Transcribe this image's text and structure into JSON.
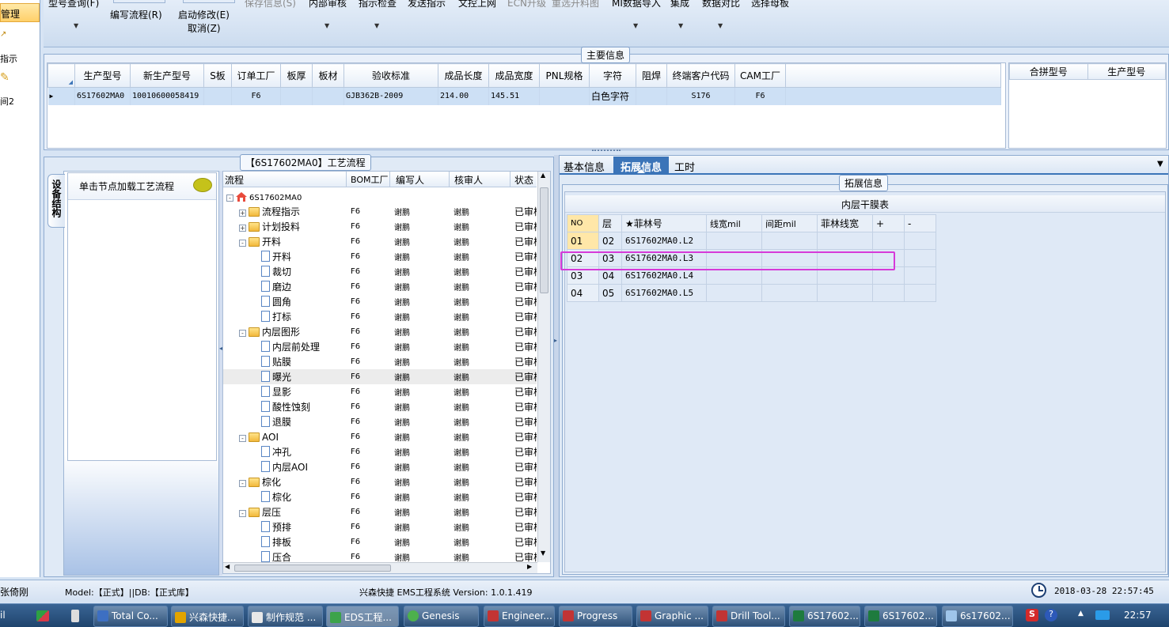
{
  "left_nav": {
    "active": "管理",
    "items": [
      "指示",
      "间2"
    ]
  },
  "toolbar": {
    "buttons": [
      {
        "label": "型号查询(F)",
        "disabled": false
      },
      {
        "label": "编写流程(R)",
        "disabled": false
      },
      {
        "label": "启动修改(E)",
        "disabled": false
      },
      {
        "label": "取消(Z)",
        "disabled": false
      },
      {
        "label": "保存信息(S)",
        "disabled": true
      },
      {
        "label": "内部审核",
        "disabled": false
      },
      {
        "label": "指示检查",
        "disabled": false
      },
      {
        "label": "发送指示",
        "disabled": false
      },
      {
        "label": "文控上网",
        "disabled": false
      },
      {
        "label": "ECN升级",
        "disabled": true
      },
      {
        "label": "重选开料图",
        "disabled": true
      },
      {
        "label": "MI数据导入",
        "disabled": false
      },
      {
        "label": "集成",
        "disabled": false
      },
      {
        "label": "数据对比",
        "disabled": false
      },
      {
        "label": "选择母板",
        "disabled": false
      }
    ]
  },
  "main_info": {
    "title": "主要信息",
    "columns": [
      "生产型号",
      "新生产型号",
      "S板",
      "订单工厂",
      "板厚",
      "板材",
      "验收标准",
      "成品长度",
      "成品宽度",
      "PNL规格",
      "字符",
      "阻焊",
      "终端客户代码",
      "CAM工厂"
    ],
    "rows": [
      [
        "6S17602MA0",
        "10010600058419",
        "",
        "F6",
        "",
        "",
        "GJB362B-2009",
        "214.00",
        "145.51",
        "",
        "白色字符",
        "",
        "S176",
        "F6"
      ]
    ],
    "merge_columns": [
      "合拼型号",
      "生产型号"
    ]
  },
  "flow_panel": {
    "title": "【6S17602MA0】工艺流程",
    "side_tab": "设备结构",
    "hint": "单击节点加载工艺流程",
    "columns": [
      "流程",
      "BOM工厂",
      "编写人",
      "核审人",
      "状态"
    ],
    "rows": [
      {
        "level": 0,
        "icon": "house",
        "exp": "-",
        "name": "6S17602MA0",
        "bom": "",
        "writer": "",
        "reviewer": "",
        "status": ""
      },
      {
        "level": 1,
        "icon": "folder",
        "exp": "+",
        "name": "流程指示",
        "bom": "F6",
        "writer": "谢鹏",
        "reviewer": "谢鹏",
        "status": "已审核"
      },
      {
        "level": 1,
        "icon": "folder",
        "exp": "+",
        "name": "计划投料",
        "bom": "F6",
        "writer": "谢鹏",
        "reviewer": "谢鹏",
        "status": "已审核"
      },
      {
        "level": 1,
        "icon": "folder",
        "exp": "-",
        "name": "开料",
        "bom": "F6",
        "writer": "谢鹏",
        "reviewer": "谢鹏",
        "status": "已审核"
      },
      {
        "level": 2,
        "icon": "doc",
        "exp": "",
        "name": "开料",
        "bom": "F6",
        "writer": "谢鹏",
        "reviewer": "谢鹏",
        "status": "已审核"
      },
      {
        "level": 2,
        "icon": "doc",
        "exp": "",
        "name": "裁切",
        "bom": "F6",
        "writer": "谢鹏",
        "reviewer": "谢鹏",
        "status": "已审核"
      },
      {
        "level": 2,
        "icon": "doc",
        "exp": "",
        "name": "磨边",
        "bom": "F6",
        "writer": "谢鹏",
        "reviewer": "谢鹏",
        "status": "已审核"
      },
      {
        "level": 2,
        "icon": "doc",
        "exp": "",
        "name": "圆角",
        "bom": "F6",
        "writer": "谢鹏",
        "reviewer": "谢鹏",
        "status": "已审核"
      },
      {
        "level": 2,
        "icon": "doc",
        "exp": "",
        "name": "打标",
        "bom": "F6",
        "writer": "谢鹏",
        "reviewer": "谢鹏",
        "status": "已审核"
      },
      {
        "level": 1,
        "icon": "folder",
        "exp": "-",
        "name": "内层图形",
        "bom": "F6",
        "writer": "谢鹏",
        "reviewer": "谢鹏",
        "status": "已审核"
      },
      {
        "level": 2,
        "icon": "doc",
        "exp": "",
        "name": "内层前处理",
        "bom": "F6",
        "writer": "谢鹏",
        "reviewer": "谢鹏",
        "status": "已审核"
      },
      {
        "level": 2,
        "icon": "doc",
        "exp": "",
        "name": "贴膜",
        "bom": "F6",
        "writer": "谢鹏",
        "reviewer": "谢鹏",
        "status": "已审核"
      },
      {
        "level": 2,
        "icon": "doc",
        "exp": "",
        "name": "曝光",
        "bom": "F6",
        "writer": "谢鹏",
        "reviewer": "谢鹏",
        "status": "已审核",
        "highlight": true
      },
      {
        "level": 2,
        "icon": "doc",
        "exp": "",
        "name": "显影",
        "bom": "F6",
        "writer": "谢鹏",
        "reviewer": "谢鹏",
        "status": "已审核"
      },
      {
        "level": 2,
        "icon": "doc",
        "exp": "",
        "name": "酸性蚀刻",
        "bom": "F6",
        "writer": "谢鹏",
        "reviewer": "谢鹏",
        "status": "已审核"
      },
      {
        "level": 2,
        "icon": "doc",
        "exp": "",
        "name": "退膜",
        "bom": "F6",
        "writer": "谢鹏",
        "reviewer": "谢鹏",
        "status": "已审核"
      },
      {
        "level": 1,
        "icon": "folder",
        "exp": "-",
        "name": "AOI",
        "bom": "F6",
        "writer": "谢鹏",
        "reviewer": "谢鹏",
        "status": "已审核"
      },
      {
        "level": 2,
        "icon": "doc",
        "exp": "",
        "name": "冲孔",
        "bom": "F6",
        "writer": "谢鹏",
        "reviewer": "谢鹏",
        "status": "已审核"
      },
      {
        "level": 2,
        "icon": "doc",
        "exp": "",
        "name": "内层AOI",
        "bom": "F6",
        "writer": "谢鹏",
        "reviewer": "谢鹏",
        "status": "已审核"
      },
      {
        "level": 1,
        "icon": "folder",
        "exp": "-",
        "name": "棕化",
        "bom": "F6",
        "writer": "谢鹏",
        "reviewer": "谢鹏",
        "status": "已审核"
      },
      {
        "level": 2,
        "icon": "doc",
        "exp": "",
        "name": "棕化",
        "bom": "F6",
        "writer": "谢鹏",
        "reviewer": "谢鹏",
        "status": "已审核"
      },
      {
        "level": 1,
        "icon": "folder",
        "exp": "-",
        "name": "层压",
        "bom": "F6",
        "writer": "谢鹏",
        "reviewer": "谢鹏",
        "status": "已审核"
      },
      {
        "level": 2,
        "icon": "doc",
        "exp": "",
        "name": "预排",
        "bom": "F6",
        "writer": "谢鹏",
        "reviewer": "谢鹏",
        "status": "已审核"
      },
      {
        "level": 2,
        "icon": "doc",
        "exp": "",
        "name": "排板",
        "bom": "F6",
        "writer": "谢鹏",
        "reviewer": "谢鹏",
        "status": "已审核"
      },
      {
        "level": 2,
        "icon": "doc",
        "exp": "",
        "name": "压合",
        "bom": "F6",
        "writer": "谢鹏",
        "reviewer": "谢鹏",
        "status": "已审核"
      }
    ]
  },
  "detail_tabs": {
    "tabs": [
      "基本信息",
      "拓展信息",
      "工时"
    ],
    "active": 1
  },
  "extended": {
    "group_title": "拓展信息",
    "table_title": "内层干膜表",
    "columns": [
      "NO",
      "层",
      "★菲林号",
      "线宽mil",
      "间距mil",
      "菲林线宽",
      "+",
      "-"
    ],
    "rows": [
      [
        "01",
        "02",
        "6S17602MA0.L2",
        "",
        "",
        "",
        "",
        ""
      ],
      [
        "02",
        "03",
        "6S17602MA0.L3",
        "",
        "",
        "",
        "",
        ""
      ],
      [
        "03",
        "04",
        "6S17602MA0.L4",
        "",
        "",
        "",
        "",
        ""
      ],
      [
        "04",
        "05",
        "6S17602MA0.L5",
        "",
        "",
        "",
        "",
        ""
      ]
    ]
  },
  "status_bar": {
    "user": "张倚刚",
    "model": "Model:【正式】||DB:【正式库】",
    "app": "兴森快捷 EMS工程系统 Version: 1.0.1.419",
    "datetime": "2018-03-28 22:57:45"
  },
  "taskbar": {
    "items": [
      "Total Co...",
      "兴森快捷...",
      "制作规范 ...",
      "EDS工程...",
      "Genesis",
      "Engineer...",
      "Progress",
      "Graphic ...",
      "Drill Tool...",
      "6S17602...",
      "6S17602...",
      "6s17602..."
    ],
    "time": "22:57",
    "start_label": "il"
  },
  "colors": {
    "accent": "#3b74b8",
    "highlight_box": "#d63ad9",
    "active_nav": "#ffd06a"
  }
}
